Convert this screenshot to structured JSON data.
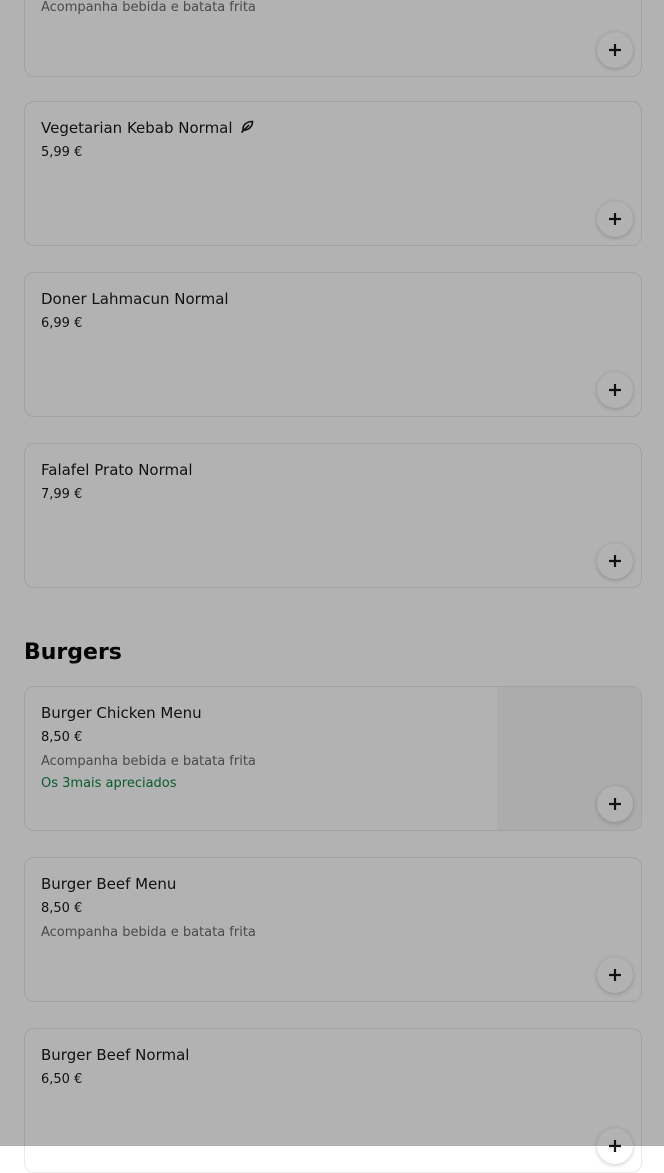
{
  "cards_top": [
    {
      "name": "",
      "price": "",
      "desc": "Acompanha bebida e batata frita"
    },
    {
      "name": "Vegetarian Kebab Normal",
      "price": "5,99 €",
      "icon": "leaf-icon"
    },
    {
      "name": "Doner Lahmacun Normal",
      "price": "6,99 €"
    },
    {
      "name": "Falafel Prato Normal",
      "price": "7,99 €"
    }
  ],
  "burgers": {
    "title": "Burgers",
    "items": [
      {
        "name": "Burger Chicken Menu",
        "price": "8,50 €",
        "desc": "Acompanha bebida e batata frita",
        "badge": "Os 3mais apreciados"
      },
      {
        "name": "Burger Beef Menu",
        "price": "8,50 €",
        "desc": "Acompanha bebida e batata frita"
      },
      {
        "name": "Burger Beef Normal",
        "price": "6,50 €"
      }
    ]
  },
  "colors": {
    "badge": "#0e8345",
    "overlay": "rgba(0,0,0,0.30)"
  }
}
